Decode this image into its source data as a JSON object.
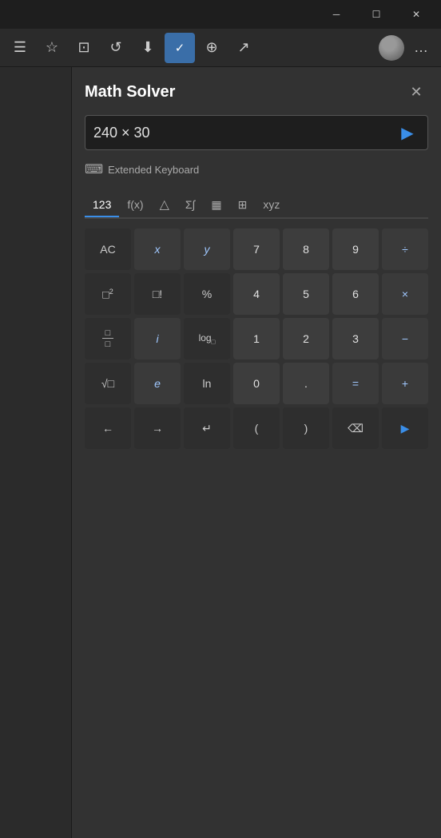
{
  "titlebar": {
    "minimize_label": "─",
    "maximize_label": "☐",
    "close_label": "✕"
  },
  "toolbar": {
    "items": [
      {
        "name": "sidebar-toggle",
        "icon": "☰"
      },
      {
        "name": "bookmark",
        "icon": "☆"
      },
      {
        "name": "screenshot",
        "icon": "⊡"
      },
      {
        "name": "history",
        "icon": "↺"
      },
      {
        "name": "download",
        "icon": "⬇"
      },
      {
        "name": "math-solver",
        "icon": "✓",
        "active": true
      },
      {
        "name": "share",
        "icon": "⊕"
      },
      {
        "name": "send",
        "icon": "↗"
      },
      {
        "name": "more",
        "icon": "…"
      }
    ]
  },
  "solver": {
    "title": "Math Solver",
    "close_label": "✕",
    "input_value": "240 × 30",
    "submit_icon": "▶",
    "ext_keyboard_label": "Extended Keyboard",
    "ext_keyboard_icon": "⌨"
  },
  "category_tabs": [
    {
      "id": "123",
      "label": "123",
      "active": true
    },
    {
      "id": "fx",
      "label": "f(x)",
      "active": false
    },
    {
      "id": "triangle",
      "label": "△",
      "active": false
    },
    {
      "id": "sigma",
      "label": "Σ∫",
      "active": false
    },
    {
      "id": "chart",
      "label": "▦",
      "active": false
    },
    {
      "id": "matrix",
      "label": "⊞",
      "active": false
    },
    {
      "id": "xyz",
      "label": "xyz",
      "active": false
    }
  ],
  "calc_buttons": [
    [
      {
        "label": "AC",
        "type": "action"
      },
      {
        "label": "x",
        "type": "var"
      },
      {
        "label": "y",
        "type": "var"
      },
      {
        "label": "7",
        "type": "num"
      },
      {
        "label": "8",
        "type": "num"
      },
      {
        "label": "9",
        "type": "num"
      },
      {
        "label": "÷",
        "type": "op"
      }
    ],
    [
      {
        "label": "□²",
        "type": "action"
      },
      {
        "label": "□!",
        "type": "action"
      },
      {
        "label": "%",
        "type": "action"
      },
      {
        "label": "4",
        "type": "num"
      },
      {
        "label": "5",
        "type": "num"
      },
      {
        "label": "6",
        "type": "num"
      },
      {
        "label": "×",
        "type": "op"
      }
    ],
    [
      {
        "label": "□/□",
        "type": "action"
      },
      {
        "label": "i",
        "type": "var"
      },
      {
        "label": "log□",
        "type": "action"
      },
      {
        "label": "1",
        "type": "num"
      },
      {
        "label": "2",
        "type": "num"
      },
      {
        "label": "3",
        "type": "num"
      },
      {
        "label": "−",
        "type": "op"
      }
    ],
    [
      {
        "label": "√□",
        "type": "action"
      },
      {
        "label": "e",
        "type": "var"
      },
      {
        "label": "ln",
        "type": "action"
      },
      {
        "label": "0",
        "type": "num"
      },
      {
        "label": ".",
        "type": "num"
      },
      {
        "label": "=",
        "type": "op"
      },
      {
        "label": "+",
        "type": "op"
      }
    ],
    [
      {
        "label": "←",
        "type": "nav"
      },
      {
        "label": "→",
        "type": "nav"
      },
      {
        "label": "↵",
        "type": "nav"
      },
      {
        "label": "(",
        "type": "action"
      },
      {
        "label": ")",
        "type": "action"
      },
      {
        "label": "⌫",
        "type": "action"
      },
      {
        "label": "▶",
        "type": "nav"
      }
    ]
  ]
}
